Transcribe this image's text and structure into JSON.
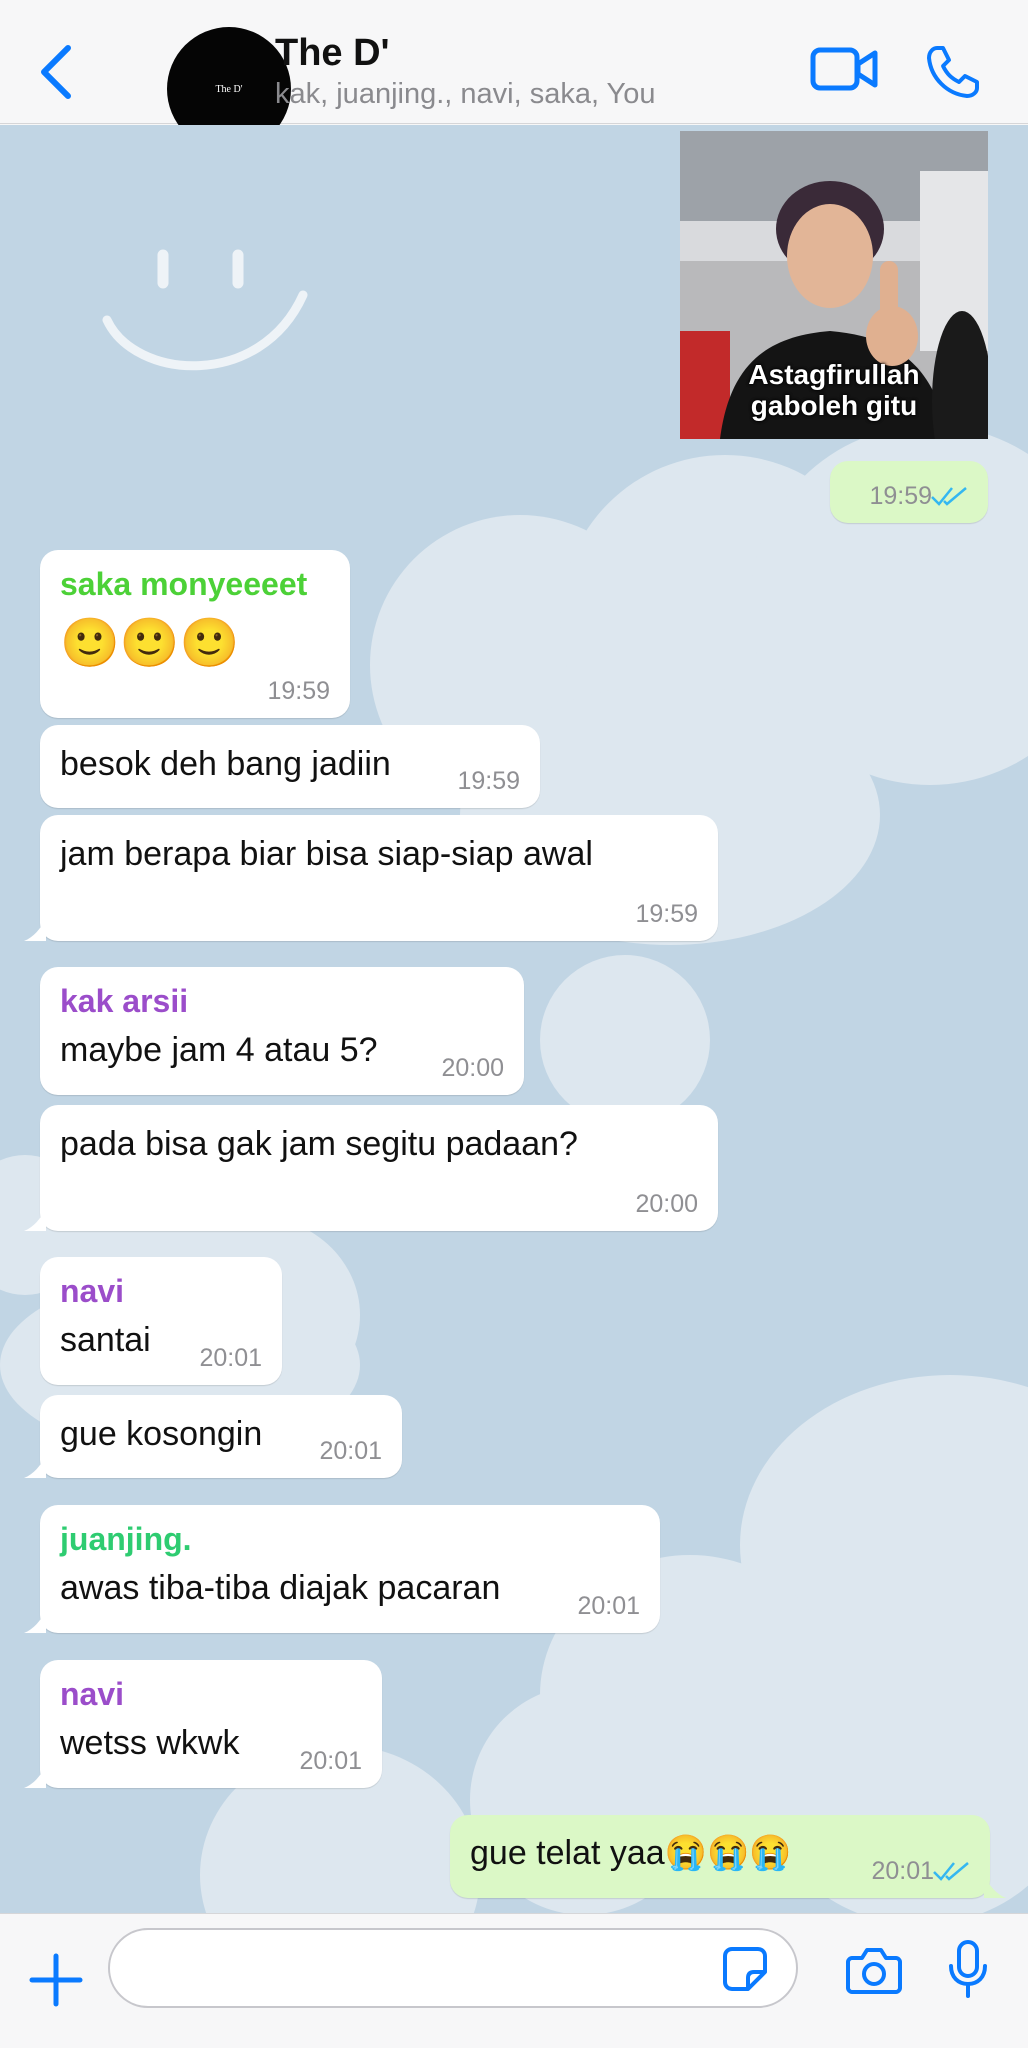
{
  "header": {
    "avatar_text": "The D'",
    "title": "The D'",
    "subtitle": "kak, juanjing., navi, saka, You"
  },
  "colors": {
    "accent": "#0a7aff",
    "outgoing_bubble": "#dbf8c6",
    "incoming_bubble": "#ffffff",
    "chat_background": "#c1d5e4",
    "sender_saka": "#4cd137",
    "sender_kak": "#9b4dca",
    "sender_navi": "#9b4dca",
    "sender_juanjing": "#2ecc71"
  },
  "sticker": {
    "caption_line1": "Astagfirullah",
    "caption_line2": "gaboleh gitu"
  },
  "messages": [
    {
      "time": "19:59"
    },
    {
      "sender": "saka monyeeeet",
      "text": "🙂🙂🙂",
      "time": "19:59"
    },
    {
      "text": "besok deh bang jadiin",
      "time": "19:59"
    },
    {
      "text": "jam berapa biar bisa siap-siap awal",
      "time": "19:59"
    },
    {
      "sender": "kak arsii",
      "text": "maybe jam 4 atau 5?",
      "time": "20:00"
    },
    {
      "text": "pada bisa gak jam segitu padaan?",
      "time": "20:00"
    },
    {
      "sender": "navi",
      "text": "santai",
      "time": "20:01"
    },
    {
      "text": "gue kosongin",
      "time": "20:01"
    },
    {
      "sender": "juanjing.",
      "text": "awas tiba-tiba diajak pacaran",
      "time": "20:01"
    },
    {
      "sender": "navi",
      "text": "wetss wkwk",
      "time": "20:01"
    },
    {
      "text": "gue telat yaa😭😭😭",
      "time": "20:01"
    }
  ],
  "composer": {
    "placeholder": ""
  },
  "icons": {
    "back": "chevron-left-icon",
    "video": "video-camera-icon",
    "call": "phone-icon",
    "plus": "plus-icon",
    "sticker": "sticker-icon",
    "camera": "camera-icon",
    "mic": "microphone-icon"
  }
}
